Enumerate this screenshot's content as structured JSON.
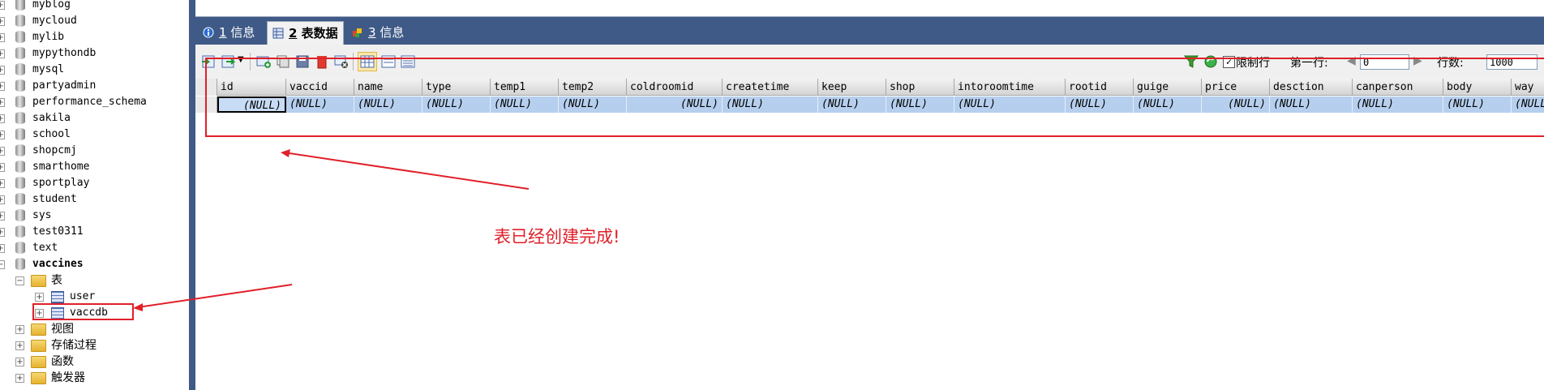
{
  "sidebar": {
    "databases": [
      "myblog",
      "mycloud",
      "mylib",
      "mypythondb",
      "mysql",
      "partyadmin",
      "performance_schema",
      "sakila",
      "school",
      "shopcmj",
      "smarthome",
      "sportplay",
      "student",
      "sys",
      "test0311",
      "text",
      "vaccines"
    ],
    "vaccines_children": {
      "tables_folder": "表",
      "tables": [
        "user",
        "vaccdb"
      ],
      "folders": [
        "视图",
        "存储过程",
        "函数",
        "触发器"
      ]
    }
  },
  "tabs": [
    {
      "num": "1",
      "label": "信息",
      "icon": "info-icon"
    },
    {
      "num": "2",
      "label": "表数据",
      "icon": "table-data-icon"
    },
    {
      "num": "3",
      "label": "信息",
      "icon": "info-multi-icon"
    }
  ],
  "toolbar": {
    "limit_rows_label": "限制行",
    "first_row_label": "第一行:",
    "first_row_value": "0",
    "row_count_label": "行数:",
    "row_count_value": "1000",
    "limit_checked": true
  },
  "grid": {
    "columns": [
      "id",
      "vaccid",
      "name",
      "type",
      "temp1",
      "temp2",
      "coldroomid",
      "createtime",
      "keep",
      "shop",
      "intoroomtime",
      "rootid",
      "guige",
      "price",
      "desction",
      "canperson",
      "body",
      "way"
    ],
    "row": [
      "(NULL)",
      "(NULL)",
      "(NULL)",
      "(NULL)",
      "(NULL)",
      "(NULL)",
      "(NULL)",
      "(NULL)",
      "(NULL)",
      "(NULL)",
      "(NULL)",
      "(NULL)",
      "(NULL)",
      "(NULL)",
      "(NULL)",
      "(NULL)",
      "(NULL)",
      "(NULL)"
    ]
  },
  "annotation": {
    "note": "表已经创建完成!",
    "color": "#e0202a"
  }
}
